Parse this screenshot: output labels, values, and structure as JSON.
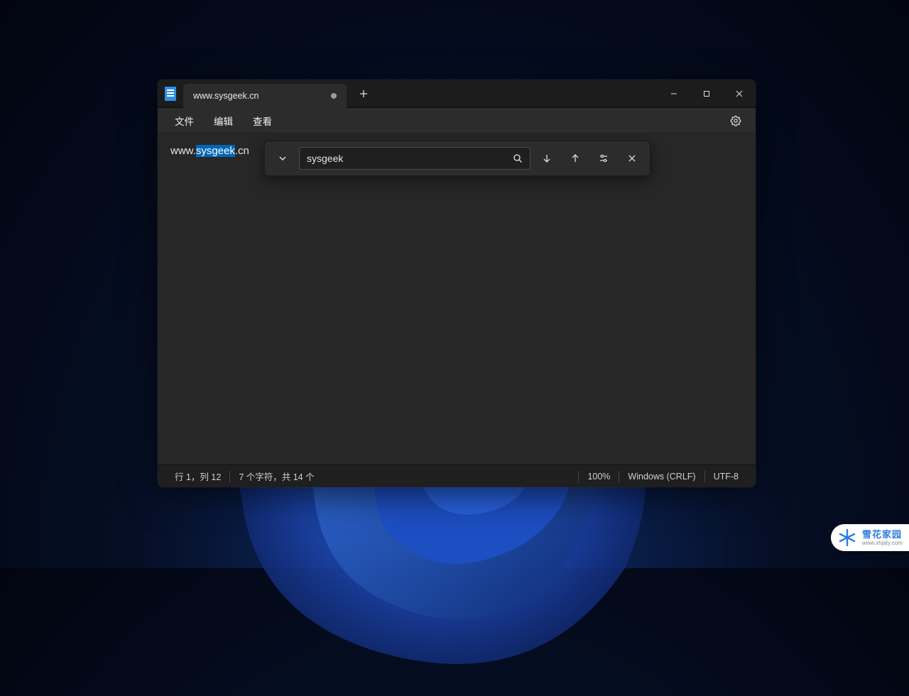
{
  "tab": {
    "title": "www.sysgeek.cn"
  },
  "menu": {
    "file": "文件",
    "edit": "编辑",
    "view": "查看"
  },
  "document": {
    "text_before": "www.",
    "text_highlight": "sysgeek",
    "text_after": ".cn"
  },
  "find": {
    "query": "sysgeek"
  },
  "status": {
    "cursor": "行 1，列 12",
    "selection": "7 个字符，共 14 个",
    "zoom": "100%",
    "eol": "Windows (CRLF)",
    "encoding": "UTF-8"
  },
  "watermark": {
    "title": "雪花家园",
    "url": "www.xhjaty.com"
  }
}
